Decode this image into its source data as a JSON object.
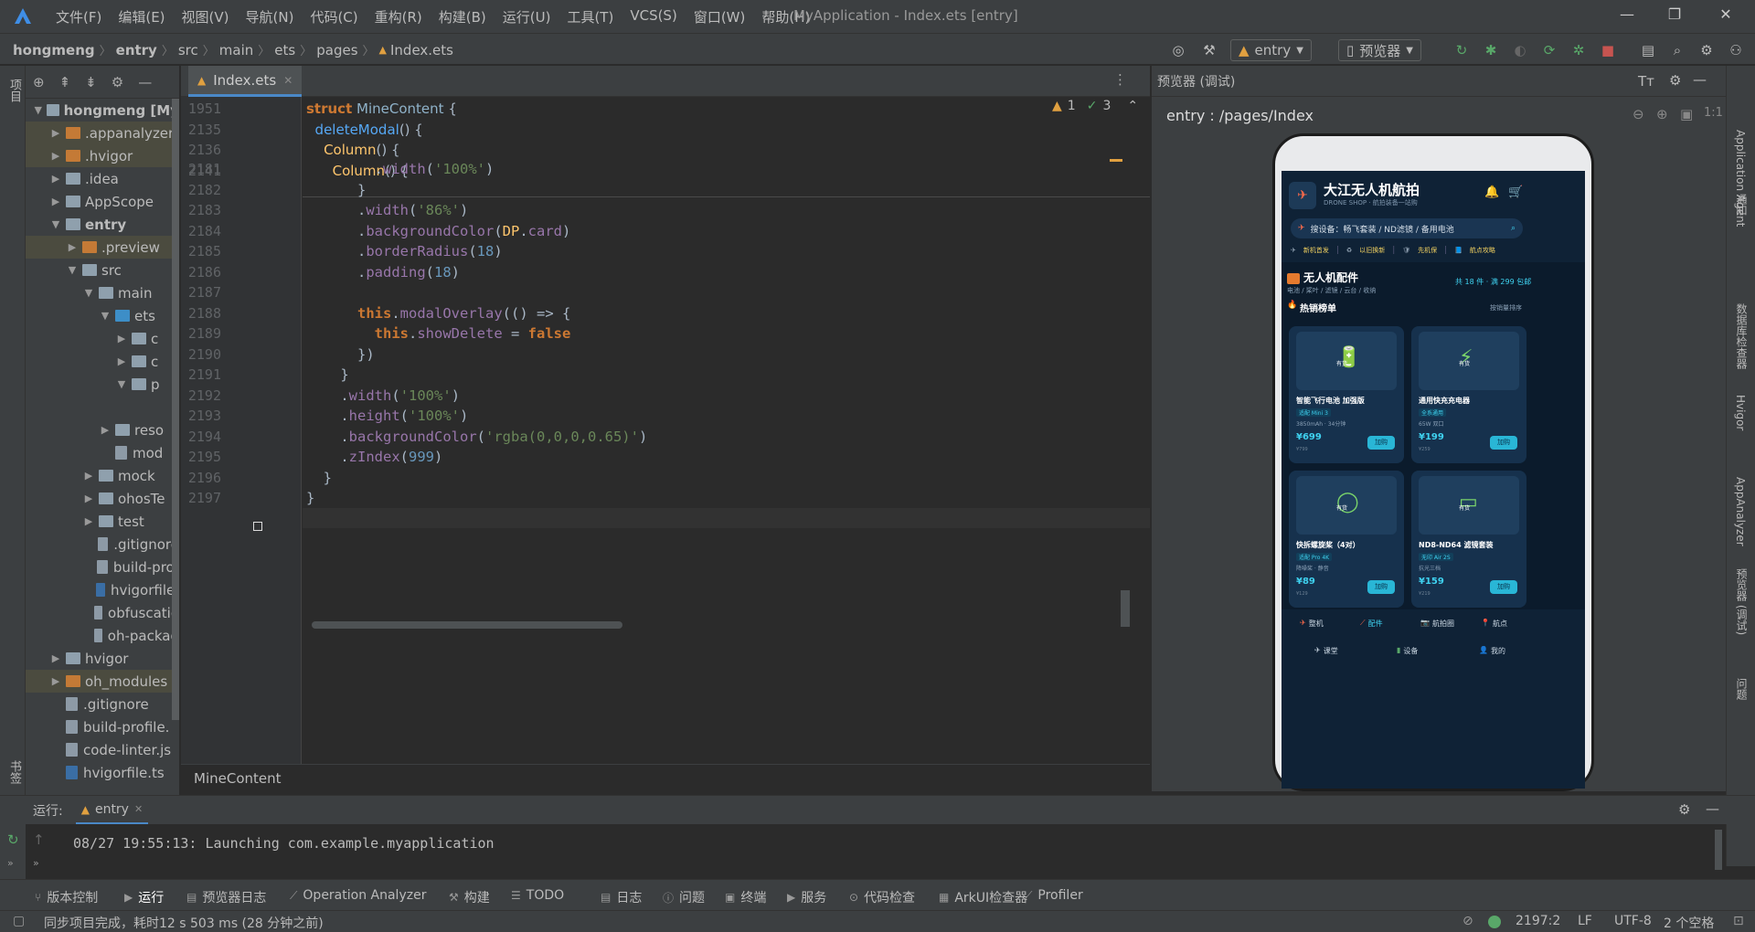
{
  "window": {
    "title": "MyApplication - Index.ets [entry]",
    "menu": [
      "文件(F)",
      "编辑(E)",
      "视图(V)",
      "导航(N)",
      "代码(C)",
      "重构(R)",
      "构建(B)",
      "运行(U)",
      "工具(T)",
      "VCS(S)",
      "窗口(W)",
      "帮助(H)"
    ]
  },
  "breadcrumb": [
    "hongmeng",
    "entry",
    "src",
    "main",
    "ets",
    "pages",
    "Index.ets"
  ],
  "toolbar": {
    "module": "entry",
    "device": "预览器"
  },
  "left_strip": {
    "project": "项目",
    "bookmarks": "书签",
    "structure": "结构"
  },
  "project_tree": [
    {
      "label": "hongmeng [My",
      "indent": 0,
      "arrow": "▼",
      "kind": "folder",
      "bold": true
    },
    {
      "label": ".appanalyzer",
      "indent": 1,
      "arrow": "▶",
      "kind": "folder-orange",
      "sel": true
    },
    {
      "label": ".hvigor",
      "indent": 1,
      "arrow": "▶",
      "kind": "folder-orange",
      "sel": true
    },
    {
      "label": ".idea",
      "indent": 1,
      "arrow": "▶",
      "kind": "folder"
    },
    {
      "label": "AppScope",
      "indent": 1,
      "arrow": "▶",
      "kind": "folder"
    },
    {
      "label": "entry",
      "indent": 1,
      "arrow": "▼",
      "kind": "folder",
      "bold": true
    },
    {
      "label": ".preview",
      "indent": 2,
      "arrow": "▶",
      "kind": "folder-orange",
      "sel": true
    },
    {
      "label": "src",
      "indent": 2,
      "arrow": "▼",
      "kind": "folder"
    },
    {
      "label": "main",
      "indent": 3,
      "arrow": "▼",
      "kind": "folder"
    },
    {
      "label": "ets",
      "indent": 4,
      "arrow": "▼",
      "kind": "folder-blue"
    },
    {
      "label": "c",
      "indent": 5,
      "arrow": "▶",
      "kind": "folder"
    },
    {
      "label": "c",
      "indent": 5,
      "arrow": "▶",
      "kind": "folder"
    },
    {
      "label": "p",
      "indent": 5,
      "arrow": "▼",
      "kind": "folder"
    },
    {
      "label": "",
      "indent": 6,
      "arrow": "",
      "kind": "none"
    },
    {
      "label": "reso",
      "indent": 4,
      "arrow": "▶",
      "kind": "folder"
    },
    {
      "label": "mod",
      "indent": 4,
      "arrow": "",
      "kind": "file"
    },
    {
      "label": "mock",
      "indent": 3,
      "arrow": "▶",
      "kind": "folder"
    },
    {
      "label": "ohosTe",
      "indent": 3,
      "arrow": "▶",
      "kind": "folder"
    },
    {
      "label": "test",
      "indent": 3,
      "arrow": "▶",
      "kind": "folder"
    },
    {
      "label": ".gitignore",
      "indent": 3,
      "arrow": "",
      "kind": "file"
    },
    {
      "label": "build-prof",
      "indent": 3,
      "arrow": "",
      "kind": "file"
    },
    {
      "label": "hvigorfile.",
      "indent": 3,
      "arrow": "",
      "kind": "file-ts"
    },
    {
      "label": "obfuscatio",
      "indent": 3,
      "arrow": "",
      "kind": "file"
    },
    {
      "label": "oh-packag",
      "indent": 3,
      "arrow": "",
      "kind": "file"
    },
    {
      "label": "hvigor",
      "indent": 1,
      "arrow": "▶",
      "kind": "folder"
    },
    {
      "label": "oh_modules",
      "indent": 1,
      "arrow": "▶",
      "kind": "folder-orange",
      "sel": true
    },
    {
      "label": ".gitignore",
      "indent": 1,
      "arrow": "",
      "kind": "file"
    },
    {
      "label": "build-profile.",
      "indent": 1,
      "arrow": "",
      "kind": "file"
    },
    {
      "label": "code-linter.js",
      "indent": 1,
      "arrow": "",
      "kind": "file"
    },
    {
      "label": "hvigorfile.ts",
      "indent": 1,
      "arrow": "",
      "kind": "file-ts"
    }
  ],
  "editor": {
    "tab": "Index.ets",
    "inspection": {
      "warnings": "1",
      "weak": "3"
    },
    "sticky_lines": [
      {
        "n": "1951",
        "code": "struct MineContent {"
      },
      {
        "n": "2135",
        "code": "  deleteModal() {"
      },
      {
        "n": "2136",
        "code": "    Column() {"
      },
      {
        "n": "2141",
        "code": "      Column() {"
      }
    ],
    "lines": [
      {
        "n": "2181",
        "code": "        .width('100%')"
      },
      {
        "n": "2182",
        "code": "      }"
      },
      {
        "n": "2183",
        "code": "      .width('86%')"
      },
      {
        "n": "2184",
        "code": "      .backgroundColor(DP.card)"
      },
      {
        "n": "2185",
        "code": "      .borderRadius(18)"
      },
      {
        "n": "2186",
        "code": "      .padding(18)"
      },
      {
        "n": "2187",
        "code": ""
      },
      {
        "n": "2188",
        "code": "      this.modalOverlay(() => {"
      },
      {
        "n": "2189",
        "code": "        this.showDelete = false"
      },
      {
        "n": "2190",
        "code": "      })"
      },
      {
        "n": "2191",
        "code": "    }"
      },
      {
        "n": "2192",
        "code": "    .width('100%')"
      },
      {
        "n": "2193",
        "code": "    .height('100%')"
      },
      {
        "n": "2194",
        "code": "    .backgroundColor('rgba(0,0,0,0.65)')"
      },
      {
        "n": "2195",
        "code": "    .zIndex(999)"
      },
      {
        "n": "2196",
        "code": "  }"
      },
      {
        "n": "2197",
        "code": "}"
      }
    ],
    "breadcrumb": "MineContent"
  },
  "preview": {
    "title": "预览器 (调试)",
    "path": "entry : /pages/Index",
    "app": {
      "brand": "大江无人机航拍",
      "brand_sub": "DRONE SHOP · 航拍装备一站购",
      "search": "搜设备：畅飞套装 / ND滤镜 / 备用电池",
      "links": [
        "新机首发",
        "以旧换新",
        "先机保",
        "航点攻略"
      ],
      "section_title": "无人机配件",
      "section_sub": "电池 / 桨叶 / 滤镜 / 云台 / 收纳",
      "section_count": "共 18 件 · 满 299 包邮",
      "hot_title": "热销榜单",
      "hot_sort": "按销量排序",
      "products": [
        {
          "name": "智能飞行电池 加强版",
          "tag": "适配 Mini 3",
          "spec": "3850mAh · 34分钟",
          "price": "¥699",
          "old": "¥799",
          "badge": "有货",
          "emoji": "🔋"
        },
        {
          "name": "通用快充充电器",
          "tag": "全系通用",
          "spec": "65W 双口",
          "price": "¥199",
          "old": "¥259",
          "badge": "有货",
          "emoji": "⚡"
        },
        {
          "name": "快拆螺旋桨（4对）",
          "tag": "适配 Pro 4K",
          "spec": "降噪桨 · 静音",
          "price": "¥89",
          "old": "¥129",
          "badge": "有货",
          "emoji": "◯"
        },
        {
          "name": "ND8-ND64 滤镜套装",
          "tag": "无印 Air 2S",
          "spec": "抗光三档",
          "price": "¥159",
          "old": "¥219",
          "badge": "有货",
          "emoji": "▭"
        }
      ],
      "add_label": "加购",
      "nav_top": [
        "整机",
        "配件",
        "航拍圈",
        "航点"
      ],
      "nav_bottom": [
        "课堂",
        "设备",
        "我的"
      ]
    }
  },
  "run": {
    "label": "运行:",
    "config": "entry",
    "output": "08/27 19:55:13: Launching com.example.myapplication"
  },
  "tool_windows": [
    "版本控制",
    "运行",
    "预览器日志",
    "Operation Analyzer",
    "构建",
    "TODO",
    "日志",
    "问题",
    "终端",
    "服务",
    "代码检查",
    "ArkUI检查器",
    "Profiler"
  ],
  "status": {
    "message": "同步项目完成，耗时12 s 503 ms (28 分钟之前)",
    "position": "2197:2",
    "line_sep": "LF",
    "encoding": "UTF-8",
    "indent": "2 个空格"
  },
  "right_strip": [
    "Application Agent",
    "通知",
    "数据库检查器",
    "Hvigor",
    "AppAnalyzer",
    "预览器 (调试)",
    "问题"
  ]
}
